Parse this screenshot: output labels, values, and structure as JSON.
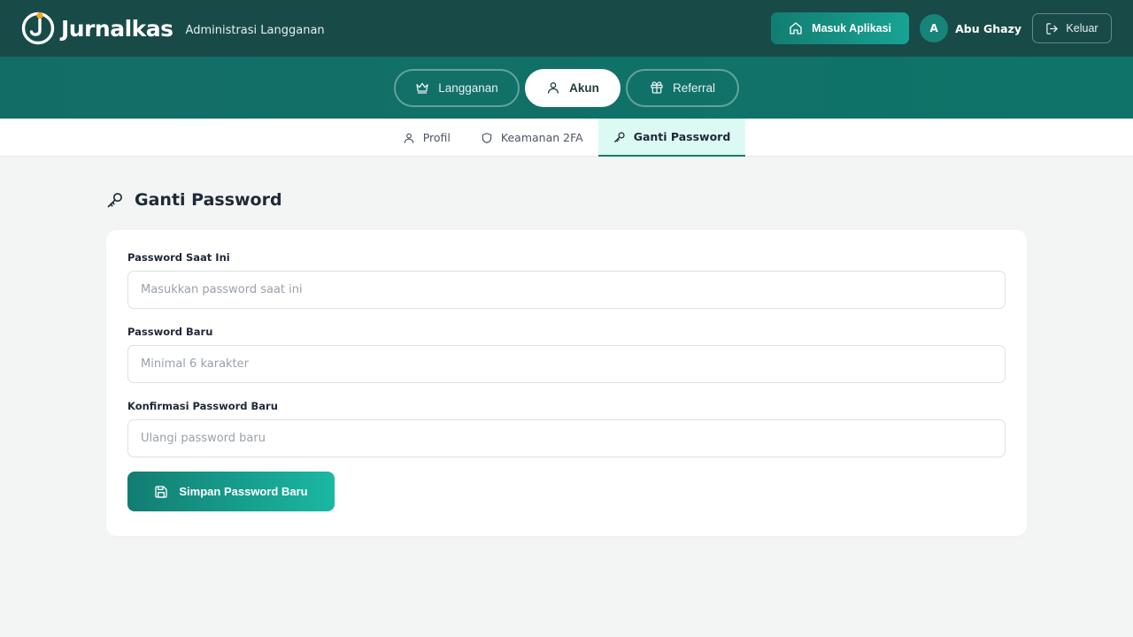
{
  "header": {
    "brand_name": "Jurnalkas",
    "subtitle": "Administrasi Langganan",
    "app_button_label": "Masuk Aplikasi",
    "avatar_initial": "A",
    "user_name": "Abu Ghazy",
    "logout_label": "Keluar"
  },
  "main_tabs": [
    {
      "label": "Langganan",
      "icon": "crown-icon",
      "active": false
    },
    {
      "label": "Akun",
      "icon": "user-icon",
      "active": true
    },
    {
      "label": "Referral",
      "icon": "gift-icon",
      "active": false
    }
  ],
  "sub_tabs": [
    {
      "label": "Profil",
      "icon": "user-icon",
      "active": false
    },
    {
      "label": "Keamanan 2FA",
      "icon": "shield-icon",
      "active": false
    },
    {
      "label": "Ganti Password",
      "icon": "key-icon",
      "active": true
    }
  ],
  "page": {
    "title": "Ganti Password",
    "title_icon": "key-icon"
  },
  "form": {
    "current_password": {
      "label": "Password Saat Ini",
      "value": "",
      "placeholder": "Masukkan password saat ini"
    },
    "new_password": {
      "label": "Password Baru",
      "value": "",
      "placeholder": "Minimal 6 karakter"
    },
    "confirm_password": {
      "label": "Konfirmasi Password Baru",
      "value": "",
      "placeholder": "Ulangi password baru"
    },
    "save_label": "Simpan Password Baru",
    "save_icon": "save-icon"
  },
  "colors": {
    "header_bg": "#184a48",
    "tabbar_bg": "#0e7469",
    "accent": "#127d72",
    "active_subtab_bg": "#dcfaf3",
    "page_bg": "#f3f5f4"
  }
}
